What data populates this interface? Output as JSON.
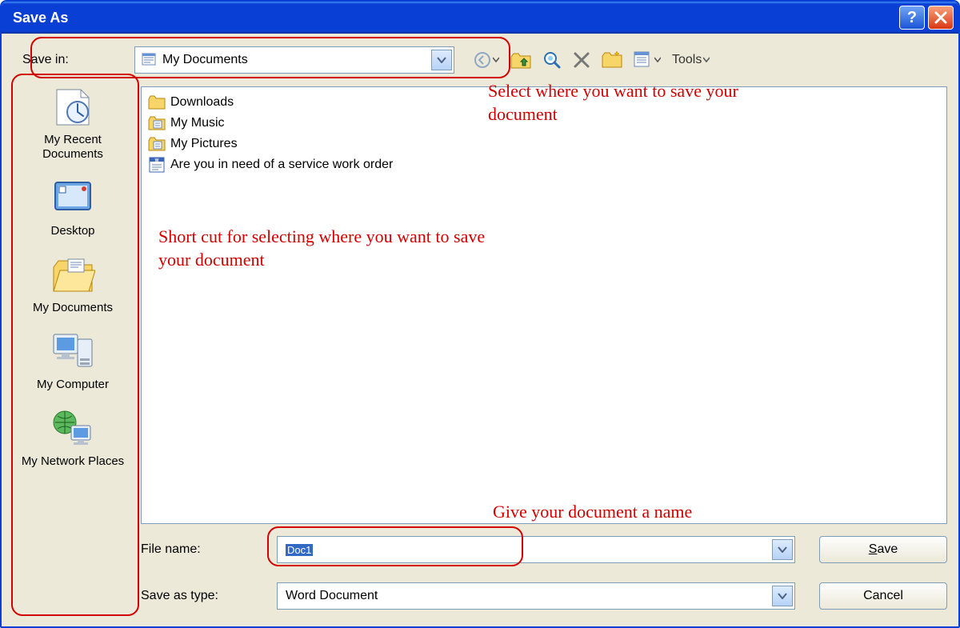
{
  "window": {
    "title": "Save As"
  },
  "toolbar": {
    "savein_label": "Save in:",
    "savein_value": "My Documents",
    "tools_label": "Tools"
  },
  "places": [
    {
      "id": "recent",
      "label": "My Recent Documents"
    },
    {
      "id": "desktop",
      "label": "Desktop"
    },
    {
      "id": "mydocs",
      "label": "My Documents"
    },
    {
      "id": "mycomp",
      "label": "My Computer"
    },
    {
      "id": "netplaces",
      "label": "My Network Places"
    }
  ],
  "files": [
    {
      "icon": "folder",
      "name": "Downloads"
    },
    {
      "icon": "folder-special",
      "name": "My Music"
    },
    {
      "icon": "folder-special",
      "name": "My Pictures"
    },
    {
      "icon": "word-doc",
      "name": "Are you in need of a service work order"
    }
  ],
  "fields": {
    "filename_label": "File name:",
    "filename_value": "Doc1",
    "filetype_label": "Save as type:",
    "filetype_value": "Word Document"
  },
  "buttons": {
    "save": "Save",
    "cancel": "Cancel"
  },
  "annotations": {
    "savein": "Select where you want to save your document",
    "shortcut": "Short cut for selecting where you want to save your document",
    "filename": "Give your document a name"
  }
}
